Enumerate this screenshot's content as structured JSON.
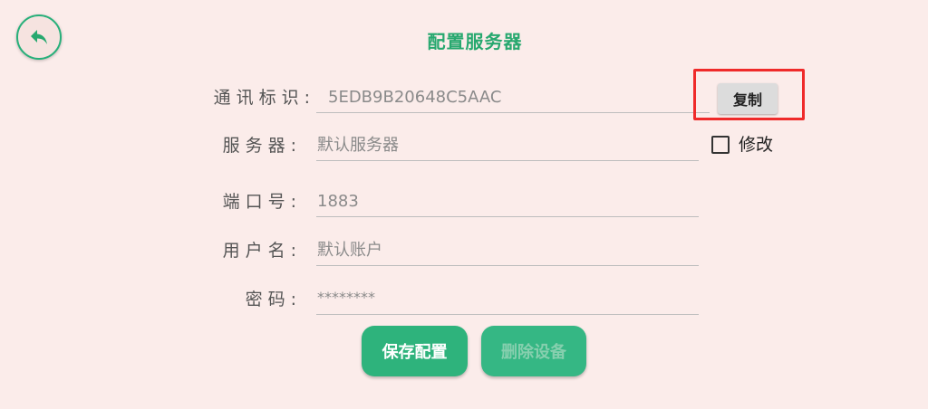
{
  "header": {
    "title": "配置服务器"
  },
  "fields": {
    "comm_id": {
      "label": "通讯标识:",
      "value": "5EDB9B20648C5AAC"
    },
    "server": {
      "label": "服务器:",
      "value": "默认服务器"
    },
    "port": {
      "label": "端口号:",
      "value": "1883"
    },
    "username": {
      "label": "用户名:",
      "value": "默认账户"
    },
    "password": {
      "label": "密码:",
      "value": "********"
    }
  },
  "actions": {
    "copy_label": "复制",
    "modify_label": "修改",
    "modify_checked": false,
    "save_label": "保存配置",
    "delete_label": "删除设备"
  },
  "colors": {
    "accent": "#2eb37c",
    "background": "#fbecea",
    "highlight": "#ef2a2a"
  }
}
